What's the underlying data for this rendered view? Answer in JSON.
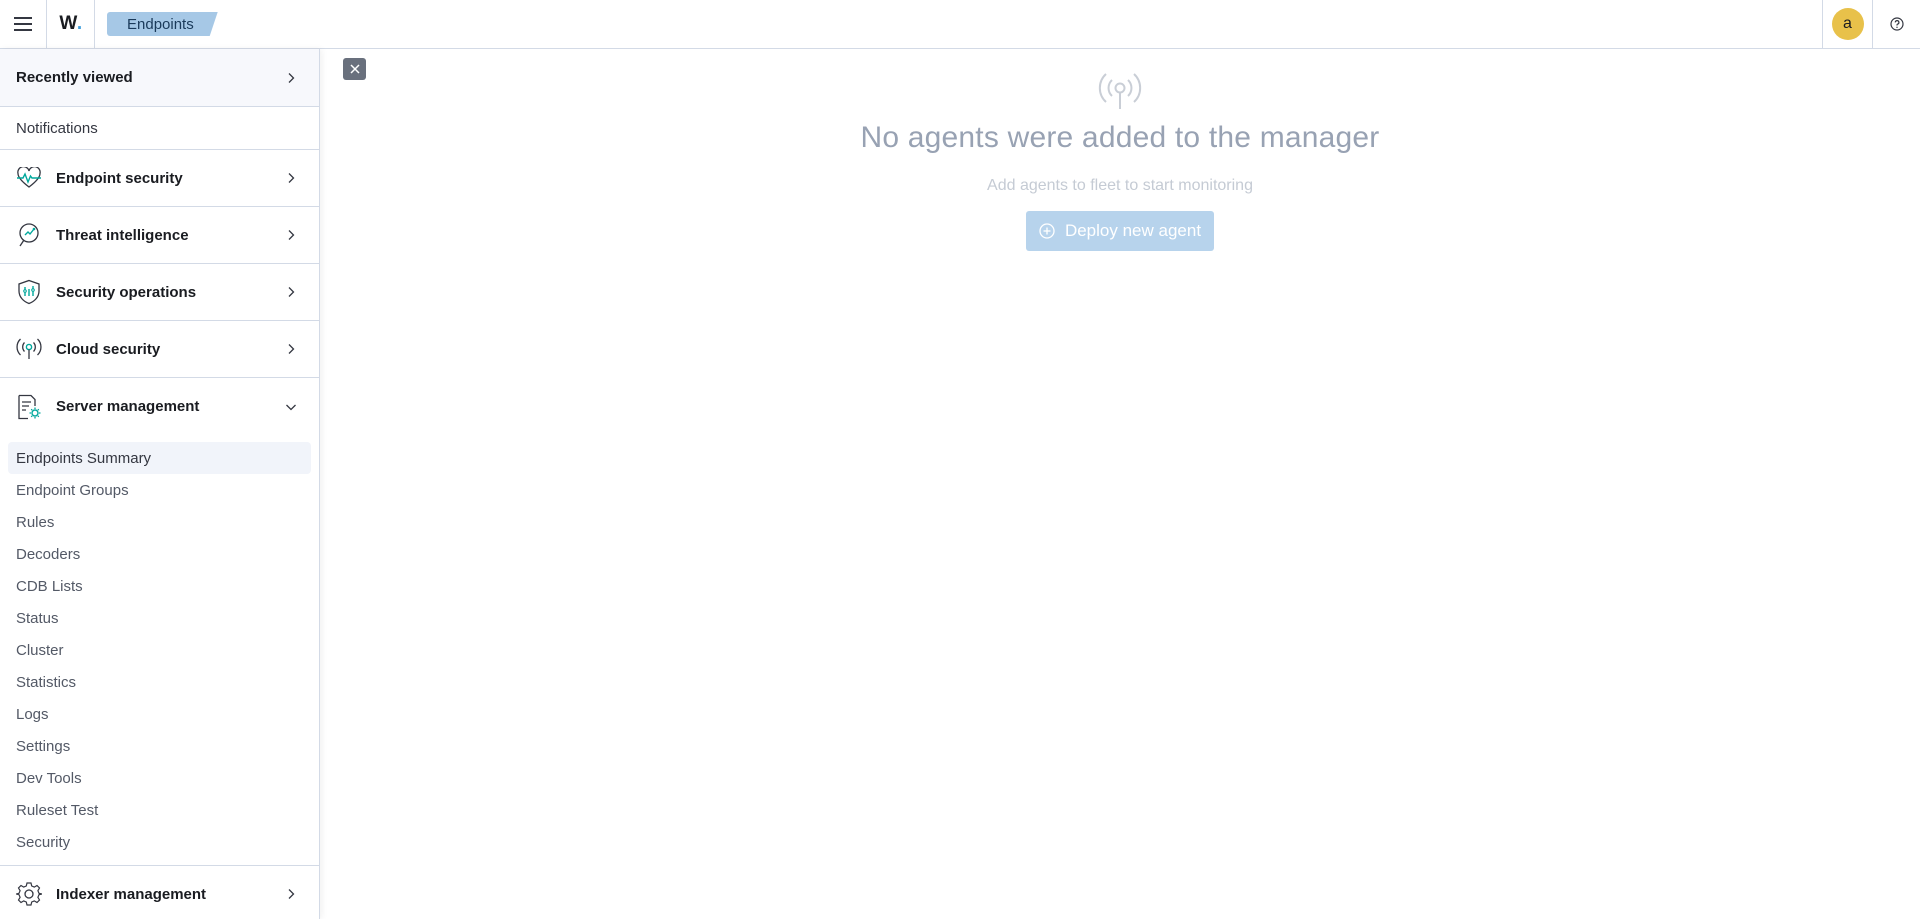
{
  "header": {
    "logo_text": "W",
    "logo_dot": ".",
    "breadcrumb": "Endpoints",
    "avatar_letter": "a"
  },
  "sidenav": {
    "recently_viewed": "Recently viewed",
    "notifications": "Notifications",
    "sections": [
      {
        "label": "Endpoint security",
        "icon": "heartbeat-icon"
      },
      {
        "label": "Threat intelligence",
        "icon": "threat-intel-icon"
      },
      {
        "label": "Security operations",
        "icon": "shield-icon"
      },
      {
        "label": "Cloud security",
        "icon": "broadcast-icon"
      }
    ],
    "server_management": "Server management",
    "server_items": [
      "Endpoints Summary",
      "Endpoint Groups",
      "Rules",
      "Decoders",
      "CDB Lists",
      "Status",
      "Cluster",
      "Statistics",
      "Logs",
      "Settings",
      "Dev Tools",
      "Ruleset Test",
      "Security"
    ],
    "indexer_management": "Indexer management"
  },
  "empty_state": {
    "title": "No agents were added to the manager",
    "subtitle": "Add agents to fleet to start monitoring",
    "button": "Deploy new agent"
  },
  "colors": {
    "accent": "#3f9ddb",
    "breadcrumb_bg": "#a6c8e6",
    "avatar_bg": "#e8c14a",
    "button_bg": "#b7d3ec"
  }
}
